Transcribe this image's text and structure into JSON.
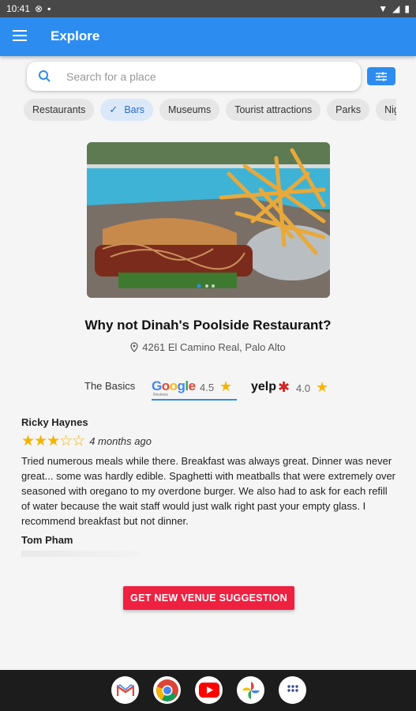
{
  "status_bar": {
    "time": "10:41"
  },
  "app_bar": {
    "title": "Explore"
  },
  "search": {
    "placeholder": "Search for a place"
  },
  "chips": [
    {
      "label": "Restaurants",
      "selected": false
    },
    {
      "label": "Bars",
      "selected": true
    },
    {
      "label": "Museums",
      "selected": false
    },
    {
      "label": "Tourist attractions",
      "selected": false
    },
    {
      "label": "Parks",
      "selected": false
    },
    {
      "label": "Nightlife",
      "selected": false
    }
  ],
  "venue": {
    "title": "Why not Dinah's Poolside Restaurant?",
    "address": "4261 El Camino Real, Palo Alto"
  },
  "rating_tabs": {
    "basics_label": "The Basics",
    "google": {
      "logo": "Google",
      "sub": "Reviews",
      "score": "4.5"
    },
    "yelp": {
      "logo": "yelp",
      "score": "4.0"
    }
  },
  "reviews": [
    {
      "author": "Ricky Haynes",
      "rating": 3,
      "time": "4 months ago",
      "text": "Tried numerous meals while there. Breakfast was always great. Dinner was never great... some was hardly edible. Spaghetti with meatballs that were extremely over seasoned with oregano to my overdone burger. We also had to ask for each refill of water because the wait staff would just walk right past your empty glass. I recommend breakfast but not dinner."
    },
    {
      "author": "Tom Pham"
    }
  ],
  "cta_label": "GET NEW VENUE SUGGESTION",
  "colors": {
    "primary": "#2d8cf0",
    "cta": "#ef2141",
    "star": "#f4b400"
  },
  "dock": [
    "gmail-icon",
    "chrome-icon",
    "youtube-icon",
    "photos-icon",
    "apps-icon"
  ]
}
